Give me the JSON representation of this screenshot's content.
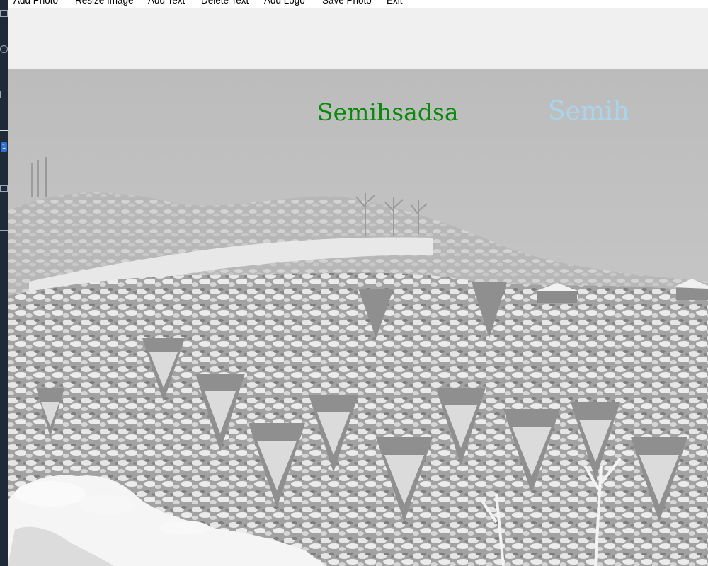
{
  "menu": {
    "items": [
      {
        "label": "Add Photo"
      },
      {
        "label": "Resize Image"
      },
      {
        "label": "Add Text"
      },
      {
        "label": "Delete Text"
      },
      {
        "label": "Add Logo"
      },
      {
        "label": "Save Photo"
      },
      {
        "label": "Exit"
      }
    ]
  },
  "left_strip": {
    "badge": "1"
  },
  "canvas": {
    "photo_icon": "snowy-forest-photo",
    "overlays": [
      {
        "text": "Semihsadsa",
        "color": "#0a8a0a"
      },
      {
        "text": "Semih",
        "color": "#a8d4ec"
      }
    ]
  },
  "colors": {
    "menubar_bg": "#ffffff",
    "toolbar_bg": "#f0f0f0",
    "sky": "#c6c6c6",
    "snow": "#f4f4f4"
  }
}
